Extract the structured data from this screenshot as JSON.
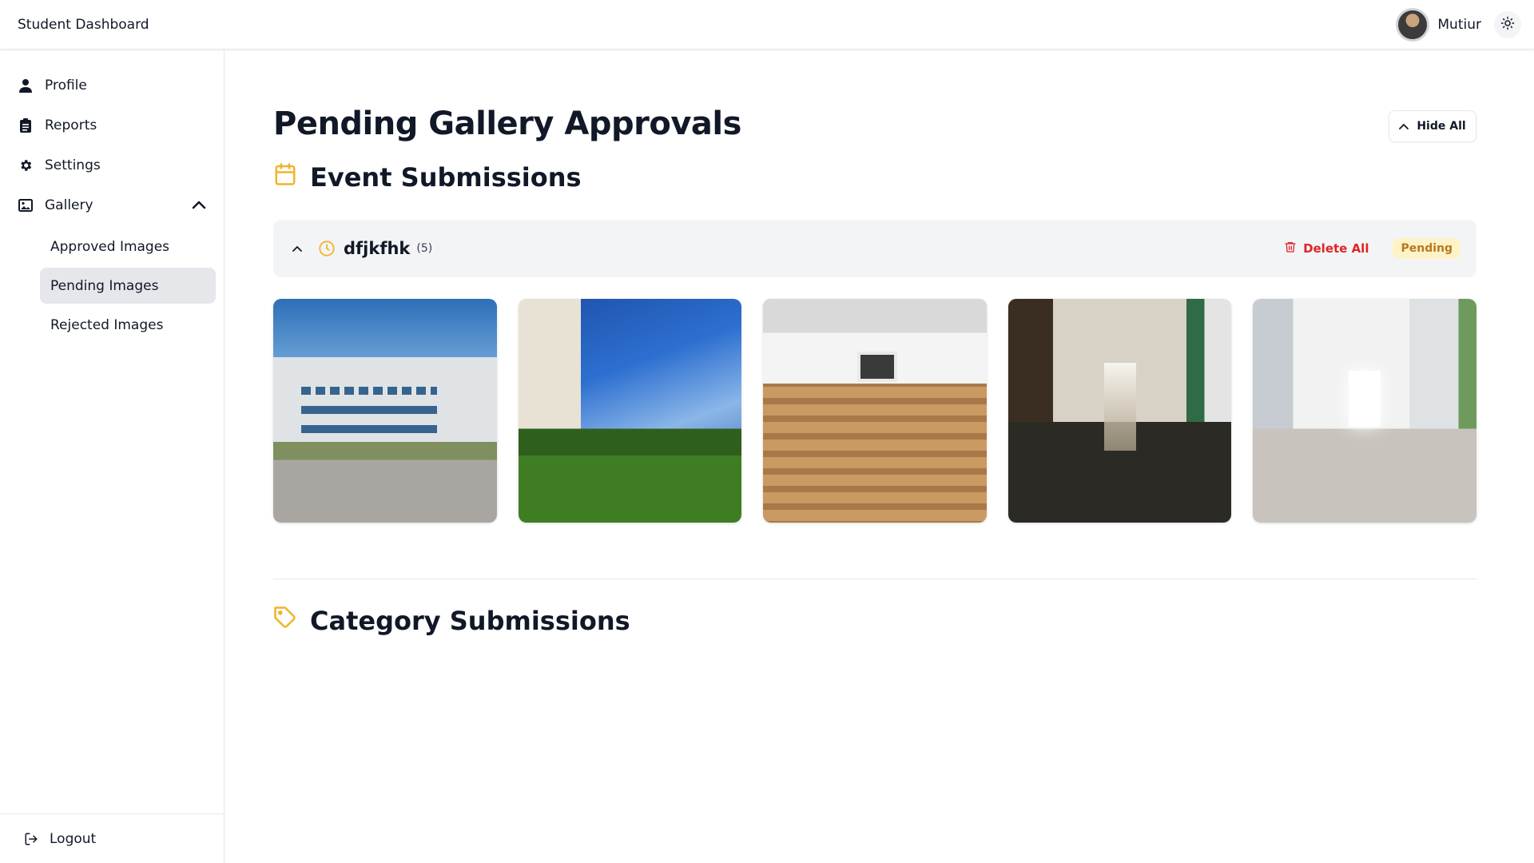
{
  "header": {
    "app_title": "Student Dashboard",
    "username": "Mutiur",
    "avatar_icon": "user-avatar",
    "theme_icon": "sun-icon"
  },
  "sidebar": {
    "items": [
      {
        "label": "Profile",
        "icon": "user-icon"
      },
      {
        "label": "Reports",
        "icon": "clipboard-icon"
      },
      {
        "label": "Settings",
        "icon": "gear-icon"
      },
      {
        "label": "Gallery",
        "icon": "image-icon",
        "expanded": true
      }
    ],
    "gallery_sub_items": [
      {
        "label": "Approved Images",
        "active": false
      },
      {
        "label": "Pending Images",
        "active": true
      },
      {
        "label": "Rejected Images",
        "active": false
      }
    ],
    "logout_label": "Logout"
  },
  "main": {
    "title": "Pending Gallery Approvals",
    "hide_all_label": "Hide All",
    "event_section_title": "Event Submissions",
    "category_section_title": "Category Submissions",
    "group": {
      "name": "dfjkfhk",
      "count": "(5)",
      "delete_all_label": "Delete All",
      "status": "Pending"
    },
    "images": [
      {
        "subject": "modern campus building with lamp post and paved walkway"
      },
      {
        "subject": "campus lawn with tall building under blue sky"
      },
      {
        "subject": "auditorium with rows of wooden seats"
      },
      {
        "subject": "long school corridor with green doors and shiny floor"
      },
      {
        "subject": "bright white school corridor"
      }
    ]
  },
  "colors": {
    "accent": "#f0b429",
    "danger": "#dc2626",
    "badge_bg": "#fef3c7",
    "badge_text": "#b7791f",
    "active_bg": "#e5e7eb"
  }
}
